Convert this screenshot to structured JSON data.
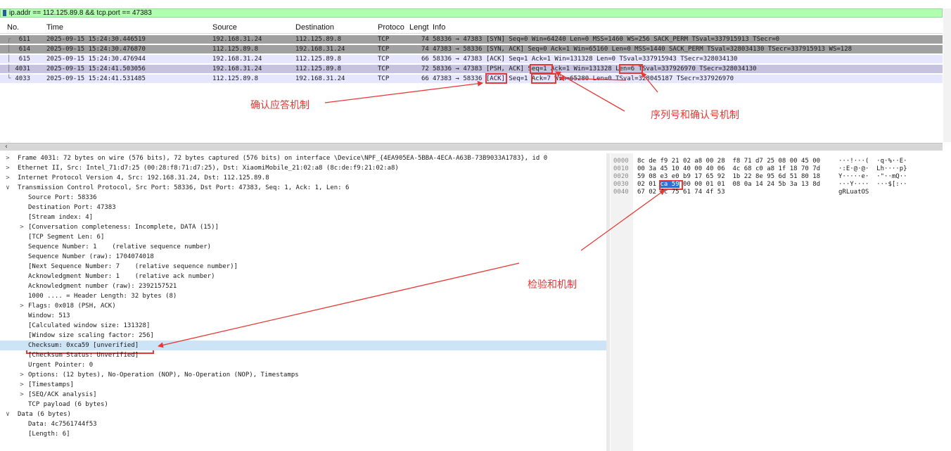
{
  "filter": {
    "text": "ip.addr == 112.125.89.8 && tcp.port == 47383"
  },
  "packet_list": {
    "columns": [
      "No.",
      "Time",
      "Source",
      "Destination",
      "Protoco",
      "Lengt",
      "Info"
    ],
    "rows": [
      {
        "no": "611",
        "time": "2025-09-15 15:24:30.446519",
        "src": "192.168.31.24",
        "dst": "112.125.89.8",
        "proto": "TCP",
        "len": "74",
        "info": "58336 → 47383 [SYN] Seq=0 Win=64240 Len=0 MSS=1460 WS=256 SACK_PERM TSval=337915913 TSecr=0"
      },
      {
        "no": "614",
        "time": "2025-09-15 15:24:30.476870",
        "src": "112.125.89.8",
        "dst": "192.168.31.24",
        "proto": "TCP",
        "len": "74",
        "info": "47383 → 58336 [SYN, ACK] Seq=0 Ack=1 Win=65160 Len=0 MSS=1440 SACK_PERM TSval=328034130 TSecr=337915913 WS=128"
      },
      {
        "no": "615",
        "time": "2025-09-15 15:24:30.476944",
        "src": "192.168.31.24",
        "dst": "112.125.89.8",
        "proto": "TCP",
        "len": "66",
        "info": "58336 → 47383 [ACK] Seq=1 Ack=1 Win=131328 Len=0 TSval=337915943 TSecr=328034130"
      },
      {
        "no": "4031",
        "time": "2025-09-15 15:24:41.503056",
        "src": "192.168.31.24",
        "dst": "112.125.89.8",
        "proto": "TCP",
        "len": "72",
        "info": "58336 → 47383 [PSH, ACK] Seq=1 Ack=1 Win=131328 Len=6 TSval=337926970 TSecr=328034130"
      },
      {
        "no": "4033",
        "time": "2025-09-15 15:24:41.531485",
        "src": "112.125.89.8",
        "dst": "192.168.31.24",
        "proto": "TCP",
        "len": "66",
        "info": "47383 → 58336 [ACK] Seq=1 Ack=7 Win=65280 Len=0 TSval=328045187 TSecr=337926970"
      }
    ]
  },
  "annotations": {
    "ack_mechanism": "确认应答机制",
    "seq_ack_mechanism": "序列号和确认号机制",
    "checksum_mechanism": "检验和机制",
    "color": "#e53935"
  },
  "details": [
    {
      "arrow": ">",
      "text": "Frame 4031: 72 bytes on wire (576 bits), 72 bytes captured (576 bits) on interface \\Device\\NPF_{4EA905EA-5BBA-4ECA-A63B-73B9033A1783}, id 0"
    },
    {
      "arrow": ">",
      "text": "Ethernet II, Src: Intel_71:d7:25 (00:28:f8:71:d7:25), Dst: XiaomiMobile_21:02:a8 (8c:de:f9:21:02:a8)"
    },
    {
      "arrow": ">",
      "text": "Internet Protocol Version 4, Src: 192.168.31.24, Dst: 112.125.89.8"
    },
    {
      "arrow": "∨",
      "text": "Transmission Control Protocol, Src Port: 58336, Dst Port: 47383, Seq: 1, Ack: 1, Len: 6"
    },
    {
      "arrow": "",
      "text": "Source Port: 58336"
    },
    {
      "arrow": "",
      "text": "Destination Port: 47383"
    },
    {
      "arrow": "",
      "text": "[Stream index: 4]"
    },
    {
      "arrow": ">",
      "text": "[Conversation completeness: Incomplete, DATA (15)]"
    },
    {
      "arrow": "",
      "text": "[TCP Segment Len: 6]"
    },
    {
      "arrow": "",
      "text": "Sequence Number: 1    (relative sequence number)"
    },
    {
      "arrow": "",
      "text": "Sequence Number (raw): 1704074018"
    },
    {
      "arrow": "",
      "text": "[Next Sequence Number: 7    (relative sequence number)]"
    },
    {
      "arrow": "",
      "text": "Acknowledgment Number: 1    (relative ack number)"
    },
    {
      "arrow": "",
      "text": "Acknowledgment number (raw): 2392157521"
    },
    {
      "arrow": "",
      "text": "1000 .... = Header Length: 32 bytes (8)"
    },
    {
      "arrow": ">",
      "text": "Flags: 0x018 (PSH, ACK)"
    },
    {
      "arrow": "",
      "text": "Window: 513"
    },
    {
      "arrow": "",
      "text": "[Calculated window size: 131328]"
    },
    {
      "arrow": "",
      "text": "[Window size scaling factor: 256]"
    },
    {
      "arrow": "",
      "text": "Checksum: 0xca59 [unverified]"
    },
    {
      "arrow": "",
      "text": "[Checksum Status: Unverified]"
    },
    {
      "arrow": "",
      "text": "Urgent Pointer: 0"
    },
    {
      "arrow": ">",
      "text": "Options: (12 bytes), No-Operation (NOP), No-Operation (NOP), Timestamps"
    },
    {
      "arrow": ">",
      "text": "[Timestamps]"
    },
    {
      "arrow": ">",
      "text": "[SEQ/ACK analysis]"
    },
    {
      "arrow": "",
      "text": "TCP payload (6 bytes)"
    },
    {
      "arrow": "∨",
      "text": "Data (6 bytes)"
    },
    {
      "arrow": "",
      "text": "Data: 4c7561744f53"
    },
    {
      "arrow": "",
      "text": "[Length: 6]"
    }
  ],
  "bytes": [
    {
      "off": "0000",
      "hex_a": "8c de f9 21 02 a8 00 28  f8 71 d7 25 08 00 45 00",
      "hex_sel": "",
      "hex_b": "",
      "ascii": "···!···(  ·q·%··E·"
    },
    {
      "off": "0010",
      "hex_a": "00 3a 45 10 40 00 40 06  4c 68 c0 a8 1f 18 70 7d",
      "hex_sel": "",
      "hex_b": "",
      "ascii": "·:E·@·@·  Lh····p}"
    },
    {
      "off": "0020",
      "hex_a": "59 08 e3 e0 b9 17 65 92  1b 22 8e 95 6d 51 80 18",
      "hex_sel": "",
      "hex_b": "",
      "ascii": "Y·····e·  ·\"··mQ··"
    },
    {
      "off": "0030",
      "hex_a": "02 01 ",
      "hex_sel": "ca 59",
      "hex_b": " 00 00 01 01  08 0a 14 24 5b 3a 13 8d",
      "ascii": "···Y····  ···$[:··"
    },
    {
      "off": "0040",
      "hex_a": "67 02 4c 75 61 74 4f 53",
      "hex_sel": "",
      "hex_b": "",
      "ascii": "gRLuatOS"
    }
  ]
}
